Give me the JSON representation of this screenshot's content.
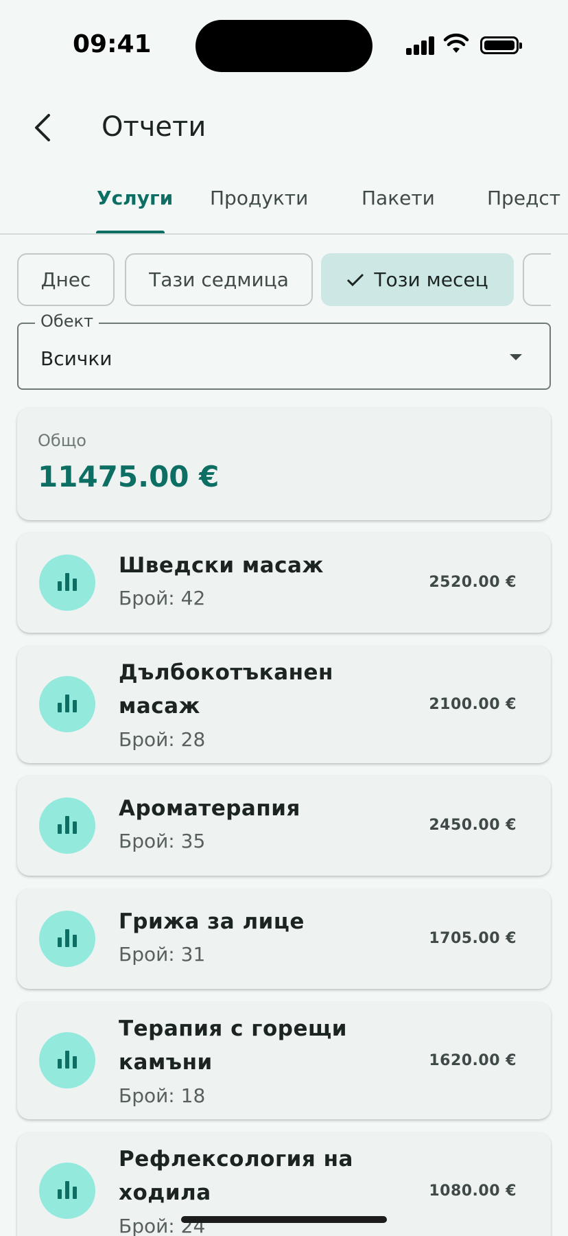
{
  "status_bar": {
    "time": "09:41"
  },
  "app_bar": {
    "title": "Отчети"
  },
  "tabs": [
    {
      "label": "Услуги",
      "active": true
    },
    {
      "label": "Продукти",
      "active": false
    },
    {
      "label": "Пакети",
      "active": false
    },
    {
      "label": "Предст",
      "active": false
    }
  ],
  "filters": {
    "chips": [
      {
        "label": "Днес",
        "selected": false
      },
      {
        "label": "Тази седмица",
        "selected": false
      },
      {
        "label": "Този месец",
        "selected": true
      }
    ]
  },
  "location_select": {
    "label": "Обект",
    "value": "Всички"
  },
  "summary": {
    "label": "Общо",
    "total": "11475.00 €"
  },
  "services": [
    {
      "name": "Шведски масаж",
      "count": "Брой: 42",
      "amount": "2520.00 €"
    },
    {
      "name": "Дълбокотъканен масаж",
      "count": "Брой: 28",
      "amount": "2100.00 €"
    },
    {
      "name": "Ароматерапия",
      "count": "Брой: 35",
      "amount": "2450.00 €"
    },
    {
      "name": "Грижа за лице",
      "count": "Брой: 31",
      "amount": "1705.00 €"
    },
    {
      "name": "Терапия с горещи камъни",
      "count": "Брой: 18",
      "amount": "1620.00 €"
    },
    {
      "name": "Рефлексология на ходила",
      "count": "Брой: 24",
      "amount": "1080.00 €"
    }
  ],
  "colors": {
    "accent": "#0d6e64",
    "avatar_bg": "#93e9dc",
    "chip_selected": "#cde8e4"
  }
}
